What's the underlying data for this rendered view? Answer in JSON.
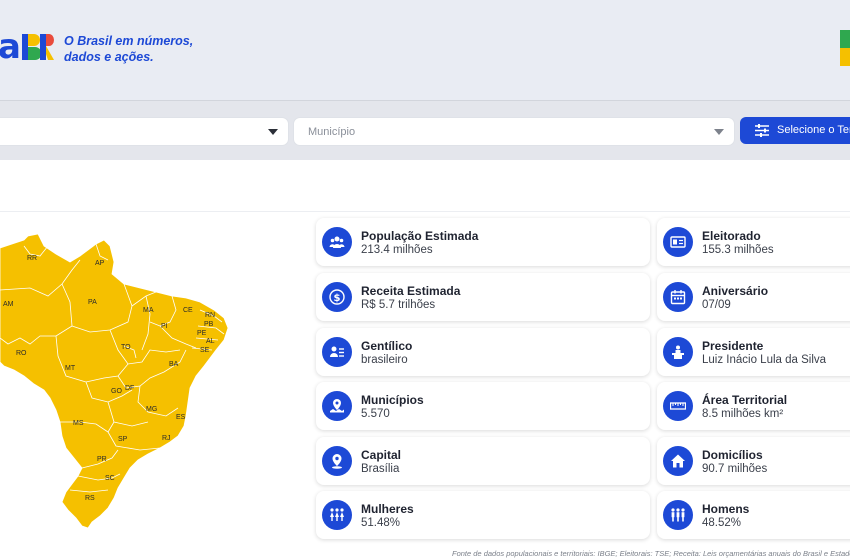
{
  "brand": {
    "logo_letter": "a",
    "tagline_line1": "O Brasil em números,",
    "tagline_line2": "dados e ações."
  },
  "filters": {
    "estado_placeholder": "",
    "municipio_placeholder": "Município",
    "select_button_label": "Selecione o Ter"
  },
  "map": {
    "fill_color": "#f5c000",
    "states": [
      "RR",
      "AP",
      "AM",
      "PA",
      "MA",
      "CE",
      "RN",
      "PB",
      "PE",
      "AL",
      "SE",
      "PI",
      "RO",
      "TO",
      "BA",
      "MT",
      "GO",
      "DF",
      "MG",
      "ES",
      "MS",
      "SP",
      "RJ",
      "PR",
      "SC",
      "RS"
    ]
  },
  "cards": [
    {
      "title": "População Estimada",
      "value": "213.4 milhões",
      "icon": "people-group-icon"
    },
    {
      "title": "Eleitorado",
      "value": "155.3 milhões",
      "icon": "voter-id-icon"
    },
    {
      "title": "Receita Estimada",
      "value": "R$ 5.7 trilhões",
      "icon": "dollar-icon"
    },
    {
      "title": "Aniversário",
      "value": "07/09",
      "icon": "calendar-icon"
    },
    {
      "title": "Gentílico",
      "value": "brasileiro",
      "icon": "id-card-icon"
    },
    {
      "title": "Presidente",
      "value": "Luiz Inácio Lula da Silva",
      "icon": "podium-icon"
    },
    {
      "title": "Municípios",
      "value": "5.570",
      "icon": "map-pins-icon"
    },
    {
      "title": "Área Territorial",
      "value": "8.5 milhões km²",
      "icon": "ruler-icon"
    },
    {
      "title": "Capital",
      "value": "Brasília",
      "icon": "map-pin-icon"
    },
    {
      "title": "Domicílios",
      "value": "90.7 milhões",
      "icon": "house-icon"
    },
    {
      "title": "Mulheres",
      "value": "51.48%",
      "icon": "women-icon"
    },
    {
      "title": "Homens",
      "value": "48.52%",
      "icon": "men-icon"
    }
  ],
  "footer": {
    "source": "Fonte de dados populacionais e territoriais: IBGE; Eleitorais: TSE; Receita: Leis orçamentárias anuais do Brasil e Estados"
  },
  "colors": {
    "accent": "#1d49d6",
    "map_yellow": "#f5c000",
    "header_bg": "#e9ecf3"
  }
}
